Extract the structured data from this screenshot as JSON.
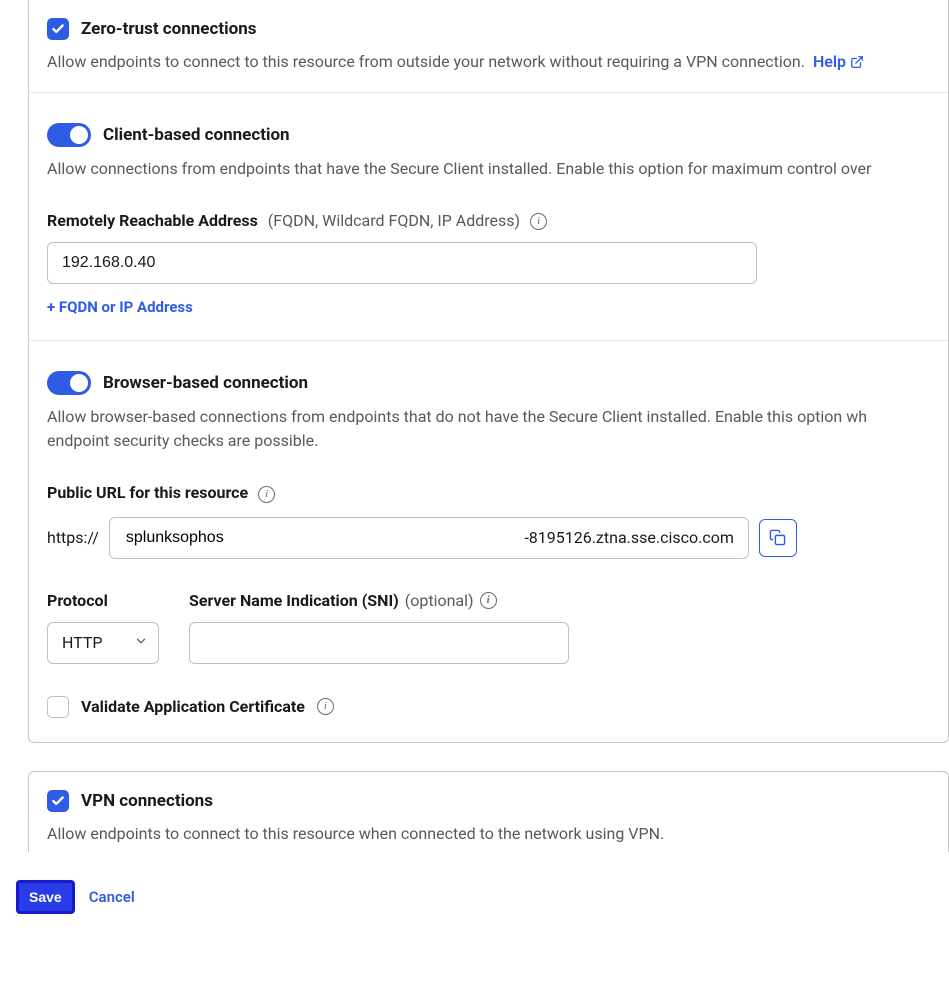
{
  "zero_trust": {
    "title": "Zero-trust connections",
    "desc": "Allow endpoints to connect to this resource from outside your network without requiring a VPN connection.",
    "help_label": "Help"
  },
  "client": {
    "title": "Client-based connection",
    "desc": "Allow connections from endpoints that have the Secure Client installed. Enable this option for maximum control over",
    "address_label": "Remotely Reachable Address",
    "address_hint": "(FQDN, Wildcard FQDN, IP Address)",
    "address_value": "192.168.0.40",
    "add_label": "+ FQDN or IP Address"
  },
  "browser": {
    "title": "Browser-based connection",
    "desc": "Allow browser-based connections from endpoints that do not have the Secure Client installed. Enable this option wh endpoint security checks are possible.",
    "public_url_label": "Public URL for this resource",
    "url_prefix": "https://",
    "url_value": "splunksophos",
    "url_suffix": "-8195126.ztna.sse.cisco.com",
    "protocol_label": "Protocol",
    "protocol_value": "HTTP",
    "sni_label": "Server Name Indication (SNI)",
    "sni_optional": "(optional)",
    "sni_value": "",
    "validate_label": "Validate Application Certificate"
  },
  "vpn": {
    "title": "VPN connections",
    "desc": "Allow endpoints to connect to this resource when connected to the network using VPN."
  },
  "actions": {
    "save": "Save",
    "cancel": "Cancel"
  }
}
